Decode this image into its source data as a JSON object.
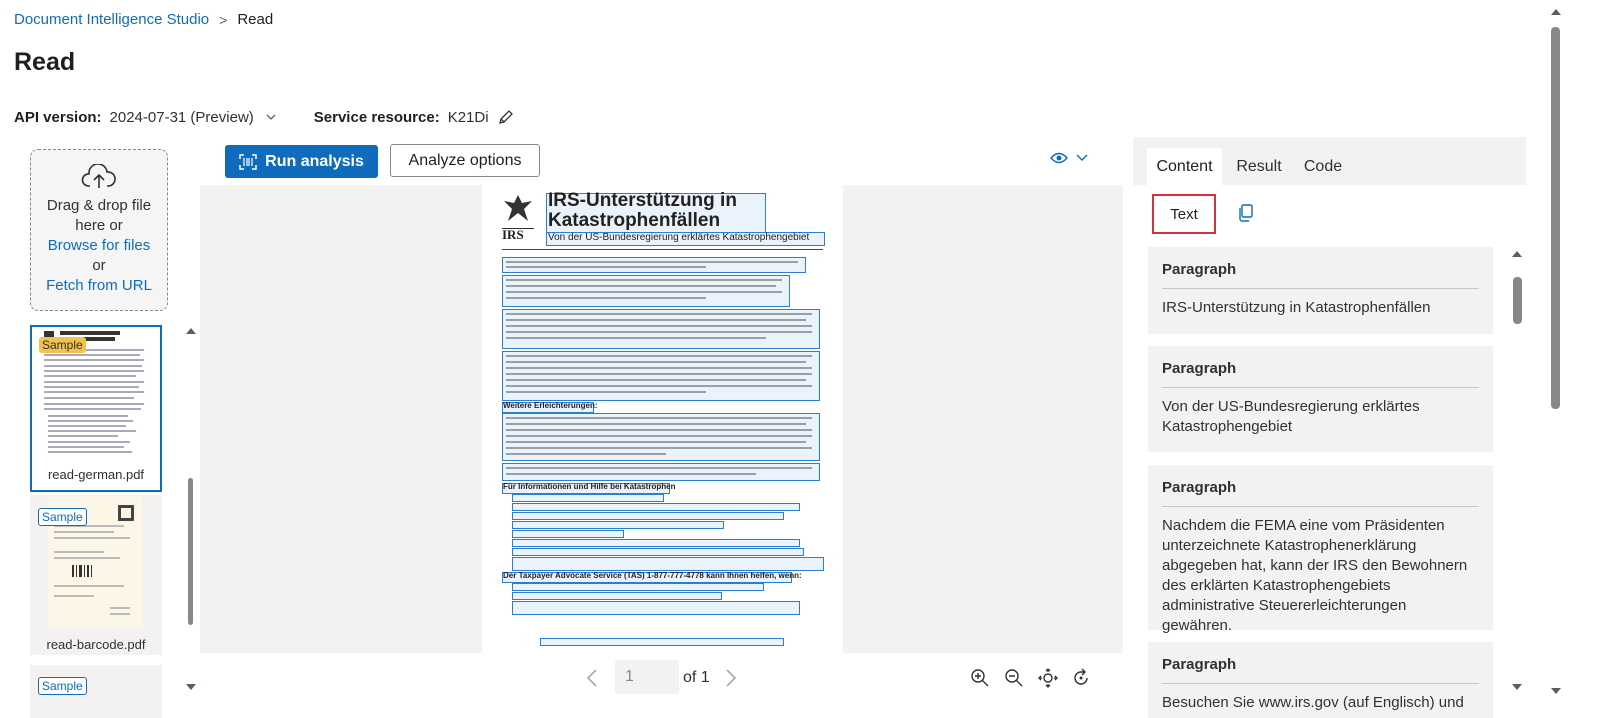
{
  "breadcrumb": {
    "parent": "Document Intelligence Studio",
    "separator": ">",
    "current": "Read"
  },
  "page_title": "Read",
  "api": {
    "label": "API version:",
    "value": "2024-07-31 (Preview)"
  },
  "service": {
    "label": "Service resource:",
    "value": "K21Di"
  },
  "upload": {
    "line1": "Drag & drop file",
    "line2": "here or",
    "browse": "Browse for files",
    "or": "or",
    "fetch": "Fetch from URL"
  },
  "files": [
    {
      "badge": "Sample",
      "name": "read-german.pdf"
    },
    {
      "badge": "Sample",
      "name": "read-barcode.pdf"
    },
    {
      "badge": "Sample",
      "name": ""
    }
  ],
  "toolbar": {
    "run": "Run analysis",
    "analyze_options": "Analyze options"
  },
  "document": {
    "title_line1": "IRS-Unterstützung in",
    "title_line2": "Katastrophenfällen",
    "subtitle": "Von der US-Bundesregierung erklärtes Katastrophengebiet",
    "logo": "IRS",
    "section1": "Weitere Erleichterungen:",
    "section2": "Für Informationen und Hilfe bei Katastrophen",
    "section3": "Der Taxpayer Advocate Service (TAS) 1-877-777-4778 kann Ihnen helfen, wenn:"
  },
  "pager": {
    "page": "1",
    "of": "of 1"
  },
  "tabs": {
    "content": "Content",
    "result": "Result",
    "code": "Code"
  },
  "text_button": "Text",
  "paragraphs": [
    {
      "heading": "Paragraph",
      "text": "IRS-Unterstützung in Katastrophenfällen"
    },
    {
      "heading": "Paragraph",
      "text": "Von der US-Bundesregierung erklärtes Katastrophengebiet"
    },
    {
      "heading": "Paragraph",
      "text": "Nachdem die FEMA eine vom Präsidenten unterzeichnete Katastrophenerklärung abgegeben hat, kann der IRS den Bewohnern des erklärten Katastrophengebiets administrative Steuererleichterungen gewähren."
    },
    {
      "heading": "Paragraph",
      "text": "Besuchen Sie www.irs.gov (auf Englisch) und"
    }
  ],
  "colors": {
    "accent": "#0f6cbd",
    "highlight_border": "#d13438",
    "sample_badge": "#f2c14e"
  }
}
